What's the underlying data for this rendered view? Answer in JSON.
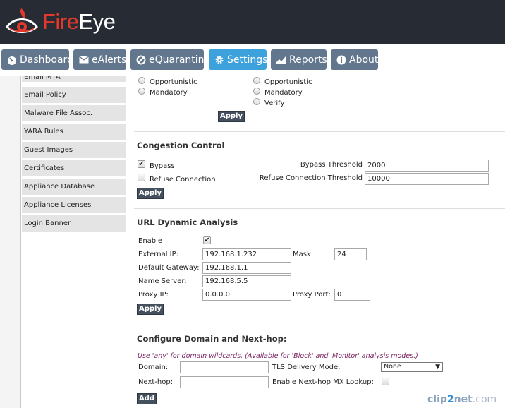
{
  "brand": {
    "fire": "Fire",
    "eye": "Eye",
    "logo_color": "#e2392c"
  },
  "nav": [
    {
      "label": "Dashboard",
      "icon": "gauge-icon"
    },
    {
      "label": "eAlerts",
      "icon": "envelope-icon"
    },
    {
      "label": "eQuarantine",
      "icon": "block-icon"
    },
    {
      "label": "Settings",
      "icon": "gear-icon",
      "active": true
    },
    {
      "label": "Reports",
      "icon": "area-chart-icon"
    },
    {
      "label": "About",
      "icon": "info-icon"
    }
  ],
  "sidebar": {
    "items": [
      "Email MTA",
      "Email Policy",
      "Malware File Assoc.",
      "YARA Rules",
      "Guest Images",
      "Certificates",
      "Appliance Database",
      "Appliance Licenses",
      "Login Banner"
    ]
  },
  "tls": {
    "left_options": [
      "Opportunistic",
      "Mandatory"
    ],
    "right_options": [
      "Opportunistic",
      "Mandatory",
      "Verify"
    ],
    "apply": "Apply"
  },
  "congestion": {
    "title": "Congestion Control",
    "bypass_label": "Bypass",
    "bypass_checked": true,
    "refuse_label": "Refuse Connection",
    "refuse_checked": false,
    "bypass_threshold_label": "Bypass Threshold",
    "bypass_threshold_value": "2000",
    "refuse_threshold_label": "Refuse Connection Threshold",
    "refuse_threshold_value": "10000",
    "apply": "Apply"
  },
  "url_analysis": {
    "title": "URL Dynamic Analysis",
    "enable_label": "Enable",
    "enable_checked": true,
    "external_ip_label": "External IP:",
    "external_ip": "192.168.1.232",
    "mask_label": "Mask:",
    "mask": "24",
    "gateway_label": "Default Gateway:",
    "gateway": "192.168.1.1",
    "name_server_label": "Name Server:",
    "name_server": "192.168.5.5",
    "proxy_ip_label": "Proxy IP:",
    "proxy_ip": "0.0.0.0",
    "proxy_port_label": "Proxy Port:",
    "proxy_port": "0",
    "apply": "Apply"
  },
  "domain": {
    "title": "Configure Domain and Next-hop:",
    "note": "Use 'any' for domain wildcards. (Available for 'Block' and 'Monitor' analysis modes.)",
    "domain_label": "Domain:",
    "domain_value": "",
    "tls_mode_label": "TLS Delivery Mode:",
    "tls_mode_value": "None",
    "nexthop_label": "Next-hop:",
    "nexthop_value": "",
    "mx_lookup_label": "Enable Next-hop MX Lookup:",
    "mx_lookup_checked": false,
    "add": "Add"
  },
  "watermark": {
    "a": "clip",
    "b": "2",
    "c": "net",
    "d": ".com"
  }
}
